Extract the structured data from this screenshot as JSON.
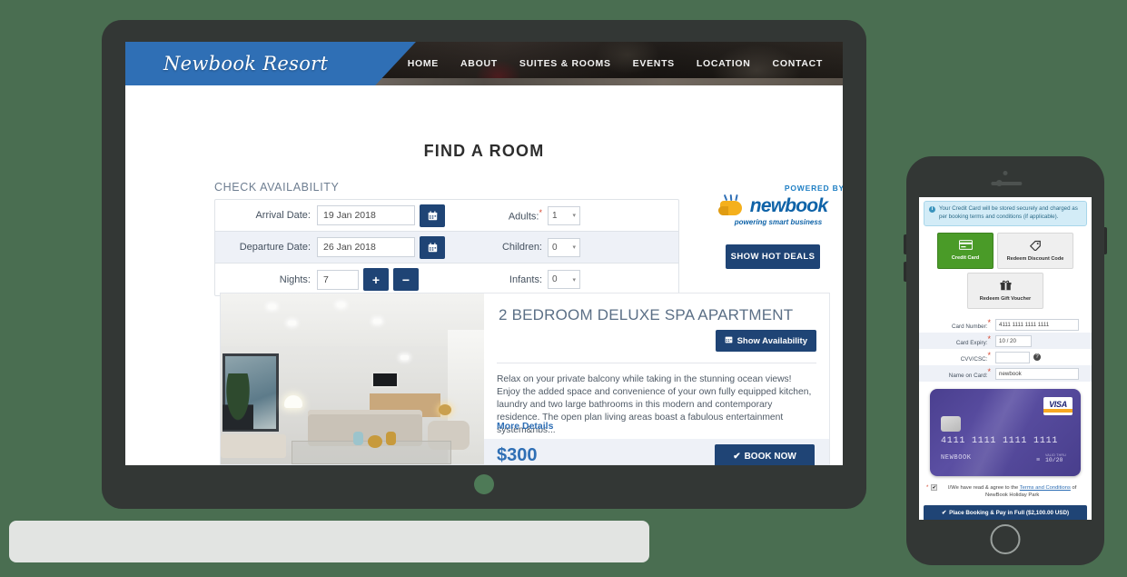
{
  "site": {
    "logo_text": "Newbook Resort",
    "nav": [
      {
        "label": "HOME"
      },
      {
        "label": "ABOUT"
      },
      {
        "label": "SUITES & ROOMS"
      },
      {
        "label": "EVENTS"
      },
      {
        "label": "LOCATION"
      },
      {
        "label": "CONTACT"
      }
    ]
  },
  "booking": {
    "page_title": "FIND A ROOM",
    "section_label": "CHECK AVAILABILITY",
    "arrival_label": "Arrival Date:",
    "arrival_value": "19 Jan 2018",
    "departure_label": "Departure Date:",
    "departure_value": "26 Jan 2018",
    "nights_label": "Nights:",
    "nights_value": "7",
    "plus_label": "+",
    "minus_label": "−",
    "calendar_icon": "Ὄ5",
    "adults_label": "Adults:",
    "adults_value": "1",
    "children_label": "Children:",
    "children_value": "0",
    "infants_label": "Infants:",
    "infants_value": "0",
    "required_star": "*",
    "caret": "▾"
  },
  "powered": {
    "powered_by": "POWERED BY",
    "brand": "newbook",
    "tagline": "powering smart business",
    "hot_deals_label": "SHOW HOT DEALS"
  },
  "room": {
    "title": "2 BEDROOM DELUXE SPA APARTMENT",
    "show_availability_label": "Show Availability",
    "description": "Relax on your private balcony while taking in the stunning ocean views! Enjoy the added space and convenience of your own fully equipped kitchen, laundry and two large bathrooms in this modern and contemporary residence. The open plan living areas boast a fabulous entertainment system&nbs...",
    "more_details_label": "More Details",
    "price": "$300",
    "book_now_label": "BOOK NOW"
  },
  "phone": {
    "notice": "Your Credit Card will be stored securely and charged as per booking terms and conditions (if applicable).",
    "notice_icon": "i",
    "pay_tabs": [
      {
        "label": "Credit Card",
        "icon": "▤"
      },
      {
        "label": "Redeem Discount Code",
        "icon": "🏷"
      },
      {
        "label": "Redeem Gift Voucher",
        "icon": "🎁"
      }
    ],
    "fields": {
      "card_number_label": "Card Number:",
      "card_number_value": "4111 1111 1111 1111",
      "card_expiry_label": "Card Expiry:",
      "card_expiry_value": "10 / 20",
      "cvv_label": "CVV/CSC:",
      "cvv_value": "",
      "cvv_help_icon": "?",
      "name_on_card_label": "Name on Card:",
      "name_on_card_value": "newbook",
      "required_star": "*"
    },
    "card_preview": {
      "brand": "VISA",
      "number": "4111  1111  1111  1111",
      "holder": "NEWBOOK",
      "expiry_caption": "VALID THRU",
      "expiry": "10/20"
    },
    "terms": {
      "star": "*",
      "checkmark": "✔",
      "text_before": "I/We have read & agree to the ",
      "link": "Terms and Conditions",
      "text_after": " of NewBook Holiday Park"
    },
    "submit_label": "Place Booking & Pay in Full ($2,100.00 USD)",
    "submit_check": "✔"
  },
  "colors": {
    "background_green": "#4a6e51",
    "device_frame": "#333735",
    "brand_blue": "#2f6fb5",
    "navy": "#1f4475",
    "active_green": "#4a9b28",
    "visa_purple": "#4a3f8f"
  }
}
